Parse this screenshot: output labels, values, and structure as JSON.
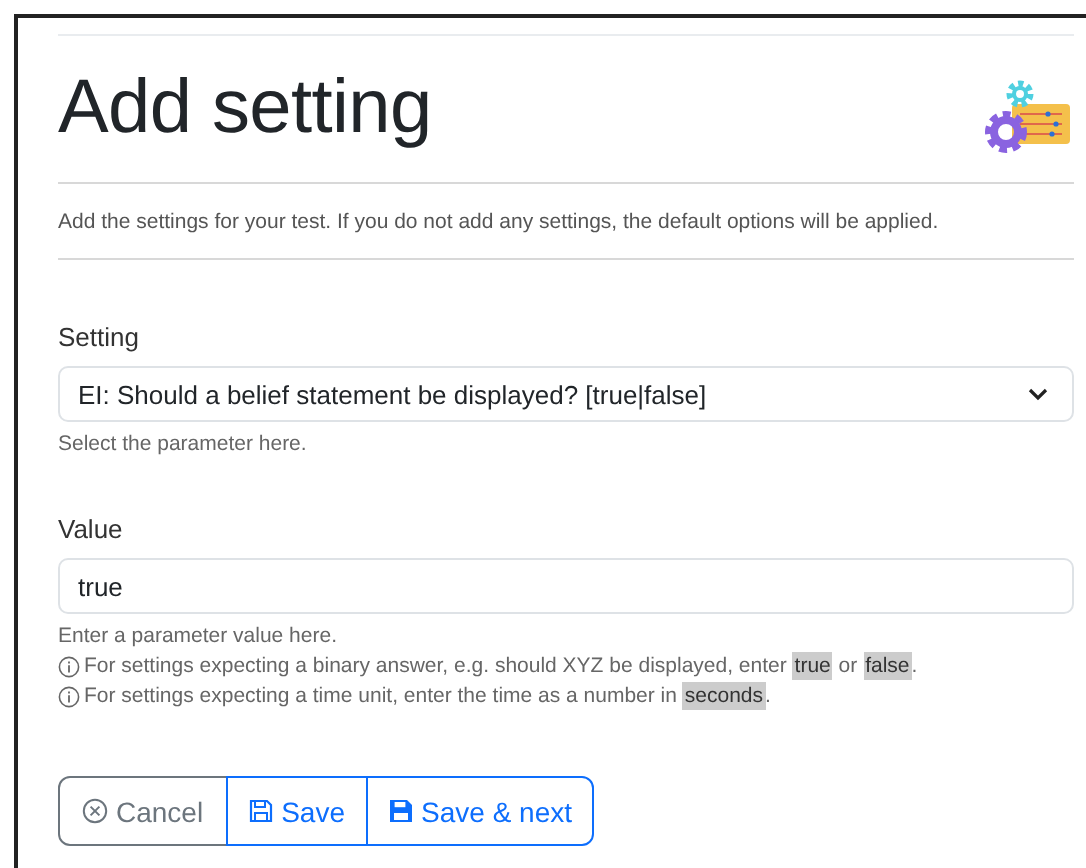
{
  "title": "Add setting",
  "description": "Add the settings for your test. If you do not add any settings, the default options will be applied.",
  "setting": {
    "label": "Setting",
    "value": "EI: Should a belief statement be displayed? [true|false]",
    "hint": "Select the parameter here."
  },
  "value_field": {
    "label": "Value",
    "value": "true",
    "hint": "Enter a parameter value here.",
    "notes": [
      [
        {
          "kind": "text",
          "text": "For settings expecting a binary answer, e.g. should XYZ be displayed, enter "
        },
        {
          "kind": "code",
          "text": "true"
        },
        {
          "kind": "text",
          "text": " or "
        },
        {
          "kind": "code",
          "text": "false"
        },
        {
          "kind": "text",
          "text": "."
        }
      ],
      [
        {
          "kind": "text",
          "text": "For settings expecting a time unit, enter the time as a number in "
        },
        {
          "kind": "code",
          "text": "seconds"
        },
        {
          "kind": "text",
          "text": "."
        }
      ]
    ]
  },
  "buttons": [
    {
      "kind": "cancel",
      "label": "Cancel"
    },
    {
      "kind": "save",
      "label": "Save"
    },
    {
      "kind": "save-next",
      "label": "Save & next"
    }
  ]
}
